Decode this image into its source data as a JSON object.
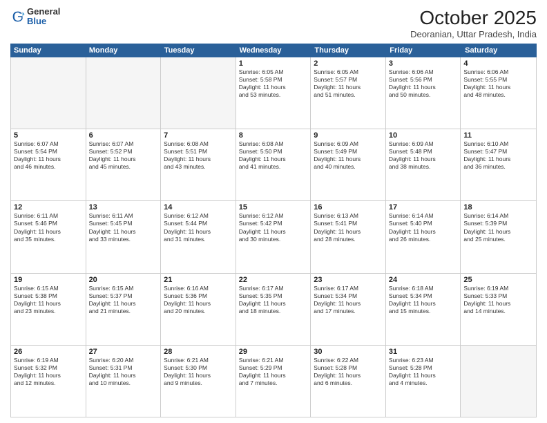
{
  "header": {
    "logo_general": "General",
    "logo_blue": "Blue",
    "month_title": "October 2025",
    "location": "Deoranian, Uttar Pradesh, India"
  },
  "weekdays": [
    "Sunday",
    "Monday",
    "Tuesday",
    "Wednesday",
    "Thursday",
    "Friday",
    "Saturday"
  ],
  "rows": [
    [
      {
        "day": "",
        "empty": true
      },
      {
        "day": "",
        "empty": true
      },
      {
        "day": "",
        "empty": true
      },
      {
        "day": "1",
        "lines": [
          "Sunrise: 6:05 AM",
          "Sunset: 5:58 PM",
          "Daylight: 11 hours",
          "and 53 minutes."
        ]
      },
      {
        "day": "2",
        "lines": [
          "Sunrise: 6:05 AM",
          "Sunset: 5:57 PM",
          "Daylight: 11 hours",
          "and 51 minutes."
        ]
      },
      {
        "day": "3",
        "lines": [
          "Sunrise: 6:06 AM",
          "Sunset: 5:56 PM",
          "Daylight: 11 hours",
          "and 50 minutes."
        ]
      },
      {
        "day": "4",
        "lines": [
          "Sunrise: 6:06 AM",
          "Sunset: 5:55 PM",
          "Daylight: 11 hours",
          "and 48 minutes."
        ]
      }
    ],
    [
      {
        "day": "5",
        "lines": [
          "Sunrise: 6:07 AM",
          "Sunset: 5:54 PM",
          "Daylight: 11 hours",
          "and 46 minutes."
        ]
      },
      {
        "day": "6",
        "lines": [
          "Sunrise: 6:07 AM",
          "Sunset: 5:52 PM",
          "Daylight: 11 hours",
          "and 45 minutes."
        ]
      },
      {
        "day": "7",
        "lines": [
          "Sunrise: 6:08 AM",
          "Sunset: 5:51 PM",
          "Daylight: 11 hours",
          "and 43 minutes."
        ]
      },
      {
        "day": "8",
        "lines": [
          "Sunrise: 6:08 AM",
          "Sunset: 5:50 PM",
          "Daylight: 11 hours",
          "and 41 minutes."
        ]
      },
      {
        "day": "9",
        "lines": [
          "Sunrise: 6:09 AM",
          "Sunset: 5:49 PM",
          "Daylight: 11 hours",
          "and 40 minutes."
        ]
      },
      {
        "day": "10",
        "lines": [
          "Sunrise: 6:09 AM",
          "Sunset: 5:48 PM",
          "Daylight: 11 hours",
          "and 38 minutes."
        ]
      },
      {
        "day": "11",
        "lines": [
          "Sunrise: 6:10 AM",
          "Sunset: 5:47 PM",
          "Daylight: 11 hours",
          "and 36 minutes."
        ]
      }
    ],
    [
      {
        "day": "12",
        "lines": [
          "Sunrise: 6:11 AM",
          "Sunset: 5:46 PM",
          "Daylight: 11 hours",
          "and 35 minutes."
        ]
      },
      {
        "day": "13",
        "lines": [
          "Sunrise: 6:11 AM",
          "Sunset: 5:45 PM",
          "Daylight: 11 hours",
          "and 33 minutes."
        ]
      },
      {
        "day": "14",
        "lines": [
          "Sunrise: 6:12 AM",
          "Sunset: 5:44 PM",
          "Daylight: 11 hours",
          "and 31 minutes."
        ]
      },
      {
        "day": "15",
        "lines": [
          "Sunrise: 6:12 AM",
          "Sunset: 5:42 PM",
          "Daylight: 11 hours",
          "and 30 minutes."
        ]
      },
      {
        "day": "16",
        "lines": [
          "Sunrise: 6:13 AM",
          "Sunset: 5:41 PM",
          "Daylight: 11 hours",
          "and 28 minutes."
        ]
      },
      {
        "day": "17",
        "lines": [
          "Sunrise: 6:14 AM",
          "Sunset: 5:40 PM",
          "Daylight: 11 hours",
          "and 26 minutes."
        ]
      },
      {
        "day": "18",
        "lines": [
          "Sunrise: 6:14 AM",
          "Sunset: 5:39 PM",
          "Daylight: 11 hours",
          "and 25 minutes."
        ]
      }
    ],
    [
      {
        "day": "19",
        "lines": [
          "Sunrise: 6:15 AM",
          "Sunset: 5:38 PM",
          "Daylight: 11 hours",
          "and 23 minutes."
        ]
      },
      {
        "day": "20",
        "lines": [
          "Sunrise: 6:15 AM",
          "Sunset: 5:37 PM",
          "Daylight: 11 hours",
          "and 21 minutes."
        ]
      },
      {
        "day": "21",
        "lines": [
          "Sunrise: 6:16 AM",
          "Sunset: 5:36 PM",
          "Daylight: 11 hours",
          "and 20 minutes."
        ]
      },
      {
        "day": "22",
        "lines": [
          "Sunrise: 6:17 AM",
          "Sunset: 5:35 PM",
          "Daylight: 11 hours",
          "and 18 minutes."
        ]
      },
      {
        "day": "23",
        "lines": [
          "Sunrise: 6:17 AM",
          "Sunset: 5:34 PM",
          "Daylight: 11 hours",
          "and 17 minutes."
        ]
      },
      {
        "day": "24",
        "lines": [
          "Sunrise: 6:18 AM",
          "Sunset: 5:34 PM",
          "Daylight: 11 hours",
          "and 15 minutes."
        ]
      },
      {
        "day": "25",
        "lines": [
          "Sunrise: 6:19 AM",
          "Sunset: 5:33 PM",
          "Daylight: 11 hours",
          "and 14 minutes."
        ]
      }
    ],
    [
      {
        "day": "26",
        "lines": [
          "Sunrise: 6:19 AM",
          "Sunset: 5:32 PM",
          "Daylight: 11 hours",
          "and 12 minutes."
        ]
      },
      {
        "day": "27",
        "lines": [
          "Sunrise: 6:20 AM",
          "Sunset: 5:31 PM",
          "Daylight: 11 hours",
          "and 10 minutes."
        ]
      },
      {
        "day": "28",
        "lines": [
          "Sunrise: 6:21 AM",
          "Sunset: 5:30 PM",
          "Daylight: 11 hours",
          "and 9 minutes."
        ]
      },
      {
        "day": "29",
        "lines": [
          "Sunrise: 6:21 AM",
          "Sunset: 5:29 PM",
          "Daylight: 11 hours",
          "and 7 minutes."
        ]
      },
      {
        "day": "30",
        "lines": [
          "Sunrise: 6:22 AM",
          "Sunset: 5:28 PM",
          "Daylight: 11 hours",
          "and 6 minutes."
        ]
      },
      {
        "day": "31",
        "lines": [
          "Sunrise: 6:23 AM",
          "Sunset: 5:28 PM",
          "Daylight: 11 hours",
          "and 4 minutes."
        ]
      },
      {
        "day": "",
        "empty": true
      }
    ]
  ]
}
